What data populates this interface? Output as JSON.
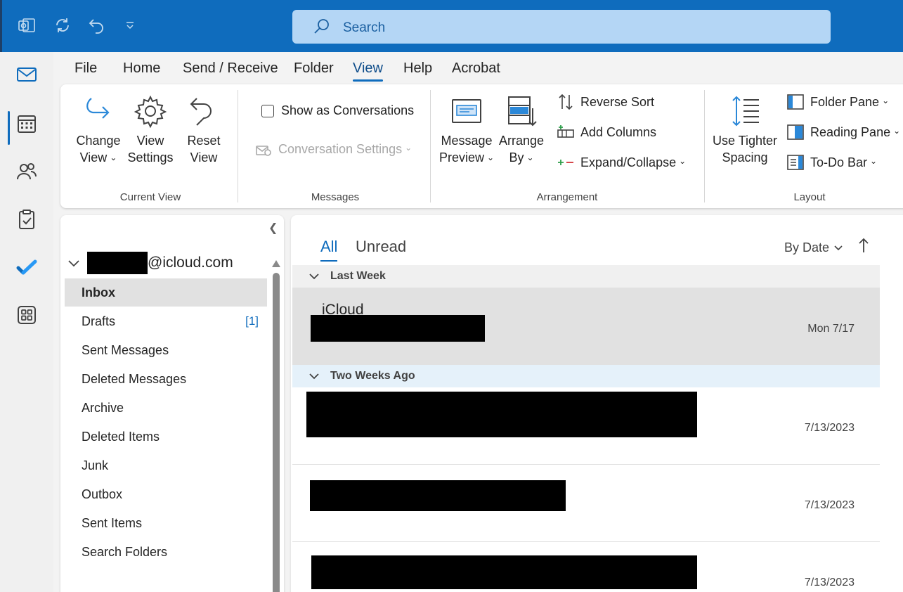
{
  "search": {
    "placeholder": "Search"
  },
  "menu": {
    "tabs": [
      {
        "label": "File",
        "active": false
      },
      {
        "label": "Home",
        "active": false
      },
      {
        "label": "Send / Receive",
        "active": false
      },
      {
        "label": "Folder",
        "active": false
      },
      {
        "label": "View",
        "active": true
      },
      {
        "label": "Help",
        "active": false
      },
      {
        "label": "Acrobat",
        "active": false
      }
    ]
  },
  "ribbon": {
    "current_view": {
      "change_view": [
        "Change",
        "View"
      ],
      "view_settings": [
        "View",
        "Settings"
      ],
      "reset_view": [
        "Reset",
        "View"
      ],
      "group_label": "Current View"
    },
    "messages": {
      "show_as_conversations": "Show as Conversations",
      "conversation_settings": "Conversation Settings",
      "group_label": "Messages"
    },
    "arrangement": {
      "message_preview": [
        "Message",
        "Preview"
      ],
      "arrange_by": [
        "Arrange",
        "By"
      ],
      "reverse_sort": "Reverse Sort",
      "add_columns": "Add Columns",
      "expand_collapse": "Expand/Collapse",
      "group_label": "Arrangement"
    },
    "layout": {
      "use_tighter_spacing": [
        "Use Tighter",
        "Spacing"
      ],
      "folder_pane": "Folder Pane",
      "reading_pane": "Reading Pane",
      "todo_bar": "To-Do Bar",
      "group_label": "Layout"
    }
  },
  "folder_pane": {
    "account_suffix": "@icloud.com",
    "folders": [
      {
        "name": "Inbox",
        "selected": true,
        "badge": ""
      },
      {
        "name": "Drafts",
        "selected": false,
        "badge": "[1]"
      },
      {
        "name": "Sent Messages",
        "selected": false,
        "badge": ""
      },
      {
        "name": "Deleted Messages",
        "selected": false,
        "badge": ""
      },
      {
        "name": "Archive",
        "selected": false,
        "badge": ""
      },
      {
        "name": "Deleted Items",
        "selected": false,
        "badge": ""
      },
      {
        "name": "Junk",
        "selected": false,
        "badge": ""
      },
      {
        "name": "Outbox",
        "selected": false,
        "badge": ""
      },
      {
        "name": "Sent Items",
        "selected": false,
        "badge": ""
      },
      {
        "name": "Search Folders",
        "selected": false,
        "badge": ""
      }
    ]
  },
  "message_list": {
    "tabs": {
      "all": "All",
      "unread": "Unread"
    },
    "sort_by": "By Date",
    "groups": [
      {
        "label": "Last Week"
      },
      {
        "label": "Two Weeks Ago"
      }
    ],
    "messages": [
      {
        "sender": "iCloud",
        "date": "Mon 7/17"
      },
      {
        "sender": "",
        "date": "7/13/2023"
      },
      {
        "sender": "",
        "date": "7/13/2023"
      },
      {
        "sender": "",
        "date": "7/13/2023"
      }
    ]
  },
  "colors": {
    "accent": "#0f6cbd",
    "titlebar": "#0f6cbd",
    "search_bg": "#b4d6f5",
    "selected_row": "#e1e1e1",
    "group_header_highlight": "#e5f1fa"
  }
}
